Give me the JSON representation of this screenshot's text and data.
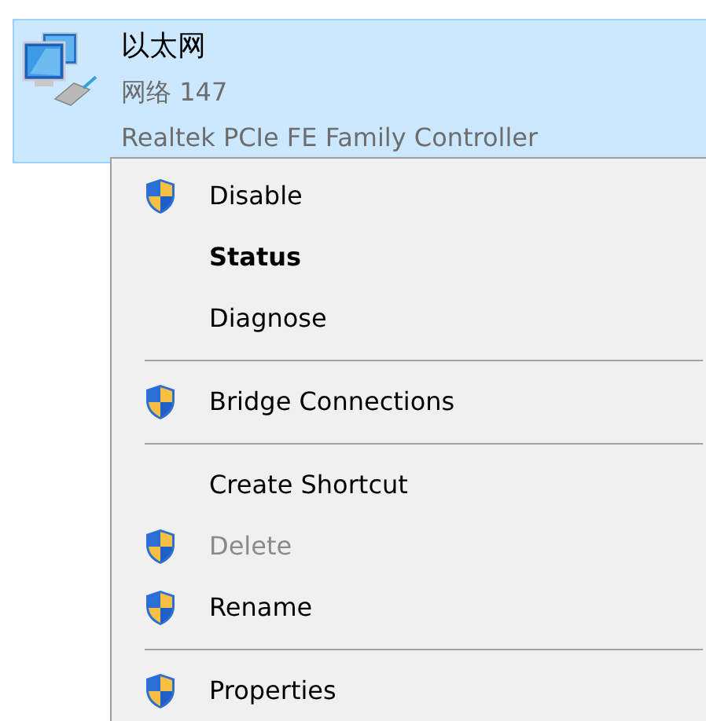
{
  "adapter": {
    "name": "以太网",
    "network": "网络 147",
    "device": "Realtek PCIe FE Family Controller",
    "selected": true
  },
  "context_menu": [
    {
      "kind": "item",
      "label": "Disable",
      "shield": true,
      "default": false,
      "disabled": false
    },
    {
      "kind": "item",
      "label": "Status",
      "shield": false,
      "default": true,
      "disabled": false
    },
    {
      "kind": "item",
      "label": "Diagnose",
      "shield": false,
      "default": false,
      "disabled": false
    },
    {
      "kind": "separator"
    },
    {
      "kind": "item",
      "label": "Bridge Connections",
      "shield": true,
      "default": false,
      "disabled": false
    },
    {
      "kind": "separator"
    },
    {
      "kind": "item",
      "label": "Create Shortcut",
      "shield": false,
      "default": false,
      "disabled": false
    },
    {
      "kind": "item",
      "label": "Delete",
      "shield": true,
      "default": false,
      "disabled": true
    },
    {
      "kind": "item",
      "label": "Rename",
      "shield": true,
      "default": false,
      "disabled": false
    },
    {
      "kind": "separator"
    },
    {
      "kind": "item",
      "label": "Properties",
      "shield": true,
      "default": false,
      "disabled": false
    }
  ]
}
